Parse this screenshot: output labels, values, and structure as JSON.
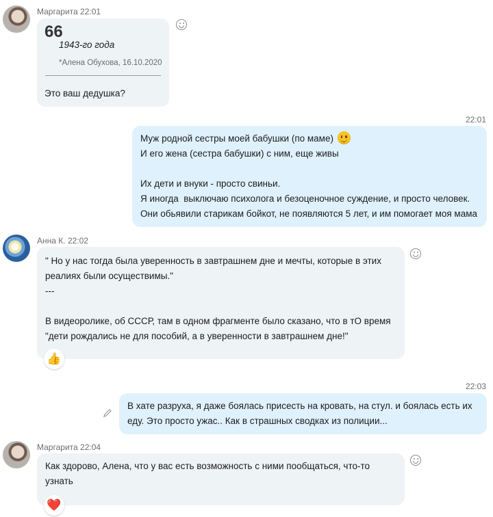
{
  "messages": {
    "m1": {
      "sender": "Маргарита",
      "time": "22:01",
      "quote": {
        "mark": "66",
        "text": "1943-го года",
        "author": "*Алена Обухова, 16.10.2020"
      },
      "text": "Это ваш дедушка?"
    },
    "m2": {
      "time": "22:01",
      "lines": [
        "Муж родной сестры моей бабушки (по маме)",
        "И его жена (сестра бабушки) с ним, еще живы",
        "",
        "Их дети и внуки - просто свиньи.",
        "Я иногда  выключаю психолога и безоценочное суждение, и просто человек.",
        "Они обьявили старикам бойкот, не появляются 5 лет, и им помогает моя мама"
      ]
    },
    "m3": {
      "sender": "Анна К.",
      "time": "22:02",
      "lines": [
        "\" Но у нас тогда была уверенность в завтрашнем дне и мечты, которые в этих",
        "реалиях были осуществимы.\"",
        "---",
        "",
        "В видеоролике, об СССР, там в одном фрагменте было сказано, что в тО время",
        "\"дети рождались не для пособий, а в уверенности в завтрашнем дне!\""
      ],
      "reaction": "👍"
    },
    "m4": {
      "time": "22:03",
      "lines": [
        "В хате разруха, я даже боялась присесть на кровать, на стул. и боялась есть их",
        "еду. Это просто ужас.. Как в страшных сводках из полиции..."
      ]
    },
    "m5": {
      "sender": "Маргарита",
      "time": "22:04",
      "lines": [
        "Как здорово, Алена, что у вас есть возможность с ними пообщаться, что-то",
        "узнать"
      ],
      "reaction": "❤️"
    }
  },
  "colors": {
    "incoming_bubble": "#eef3f6",
    "outgoing_bubble": "#dff1fc"
  }
}
